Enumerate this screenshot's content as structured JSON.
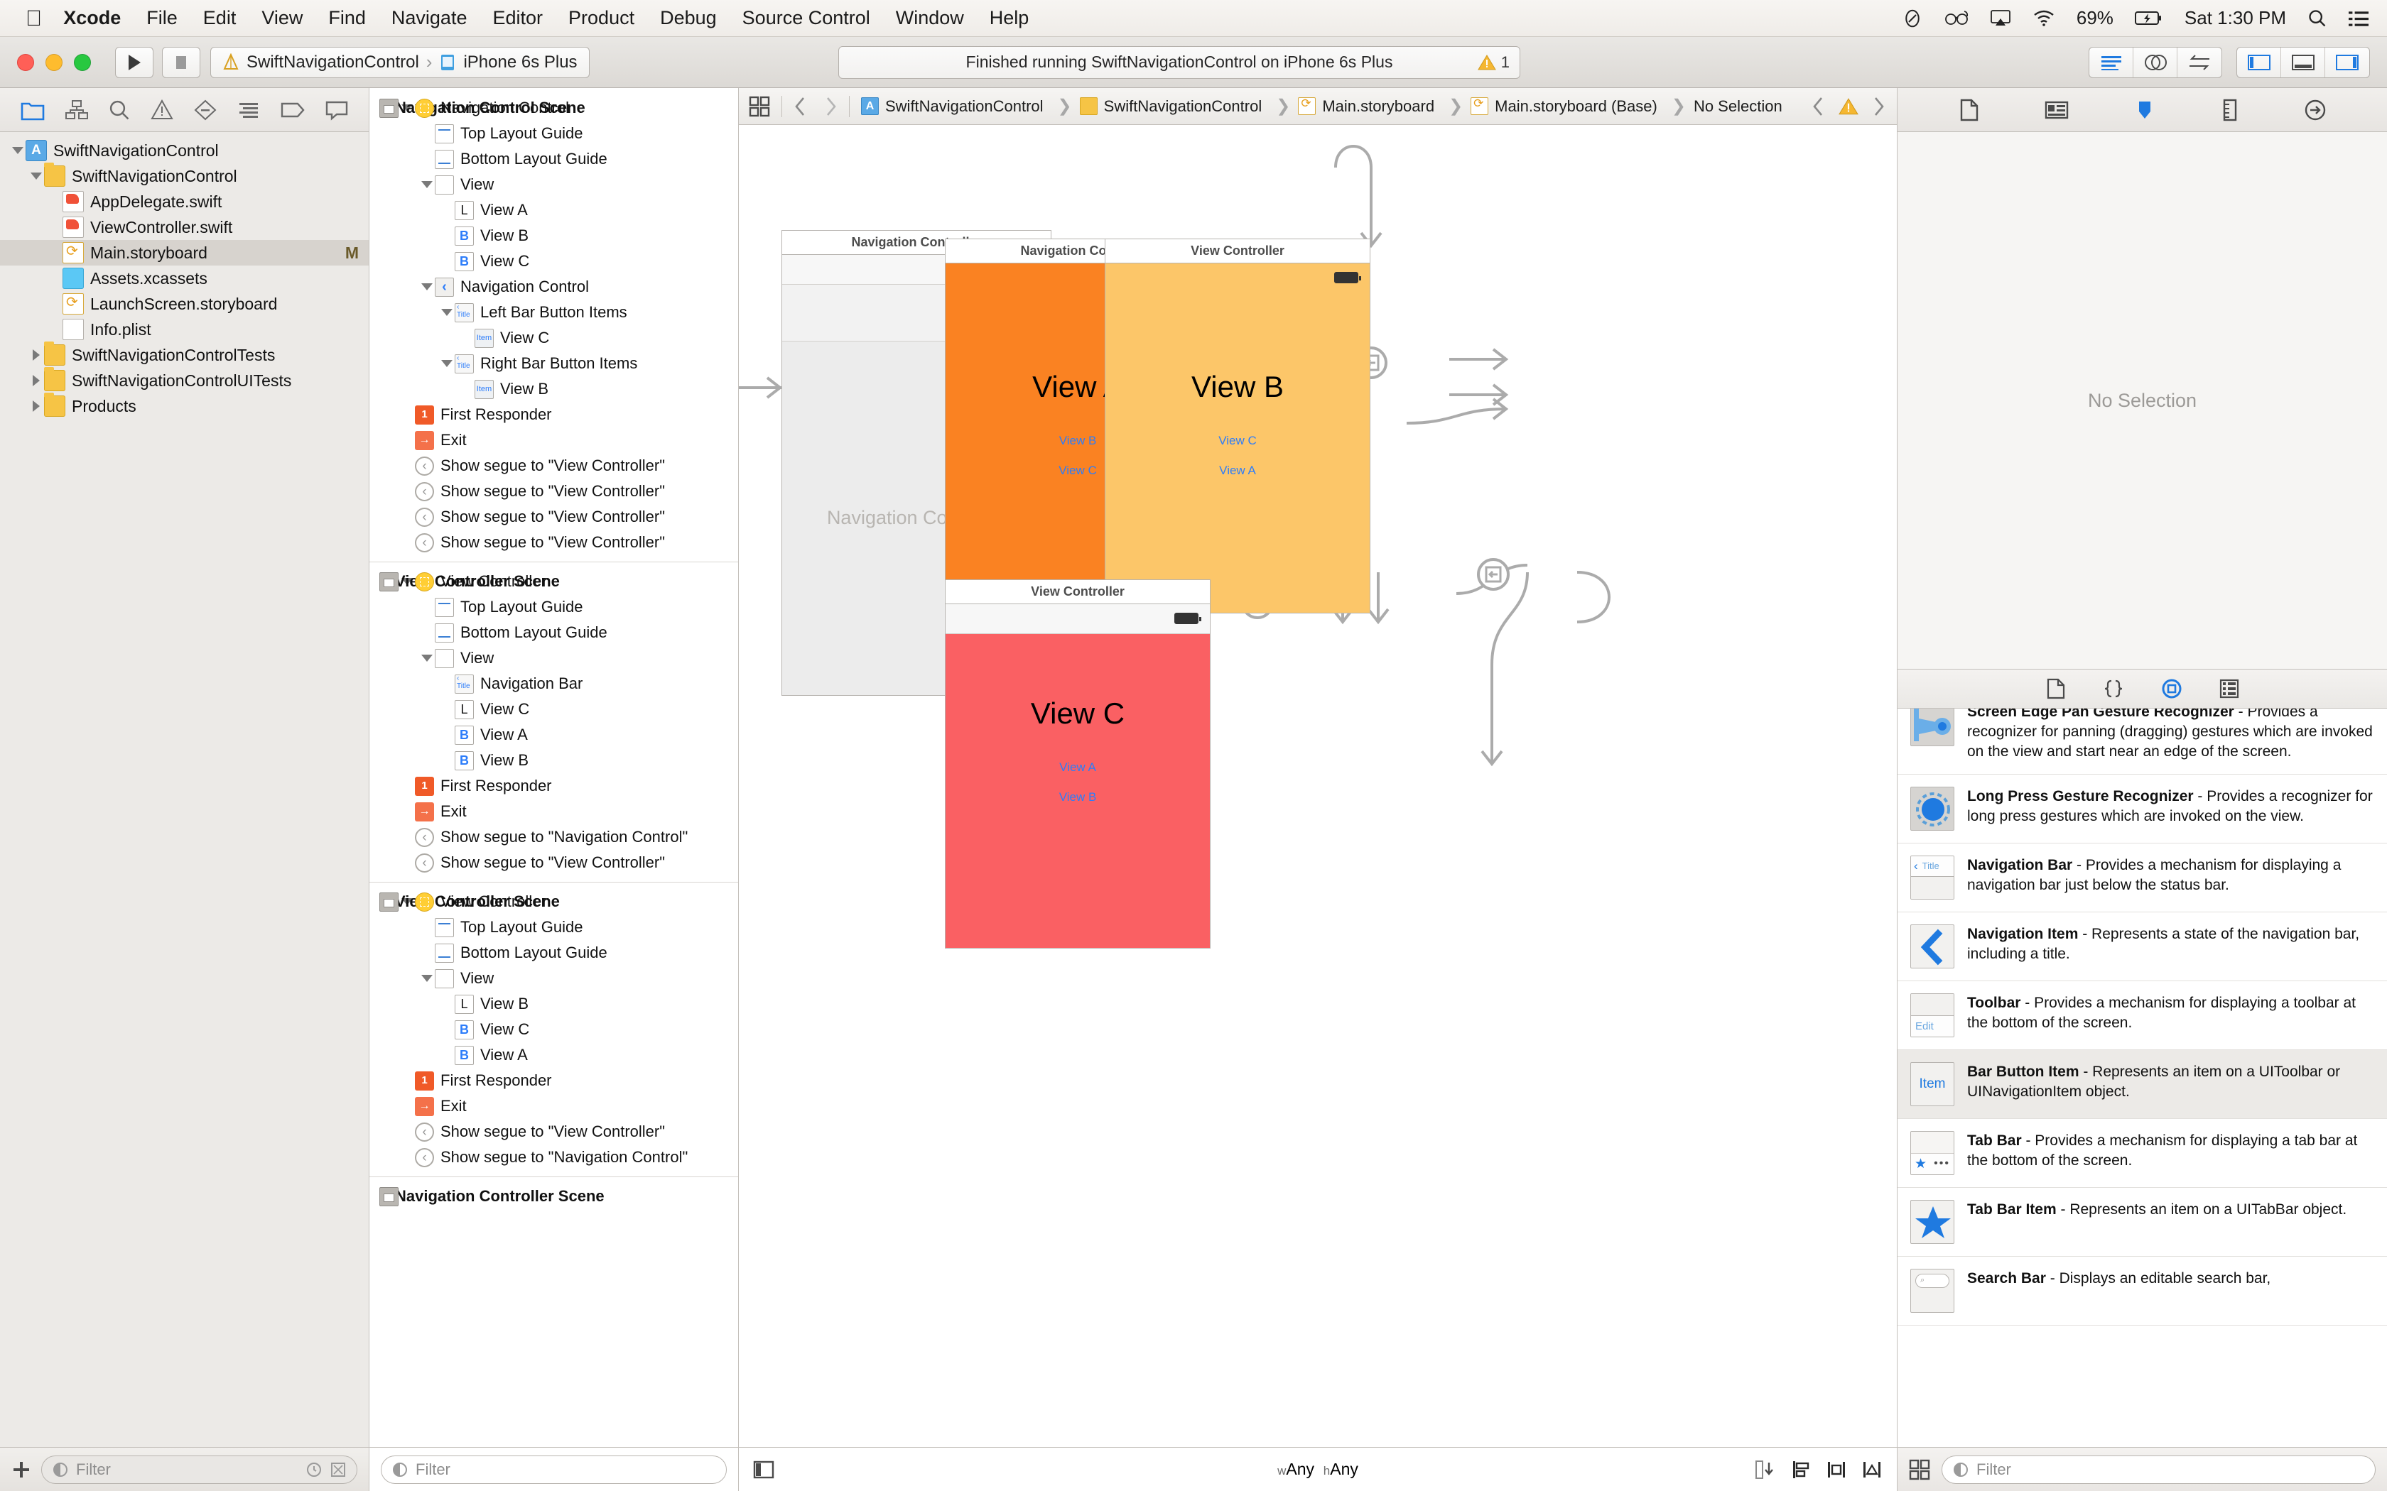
{
  "menubar": {
    "apple_icon": "apple-icon",
    "items": [
      "Xcode",
      "File",
      "Edit",
      "View",
      "Find",
      "Navigate",
      "Editor",
      "Product",
      "Debug",
      "Source Control",
      "Window",
      "Help"
    ],
    "status": {
      "battery_percent": "69%",
      "clock": "Sat 1:30 PM"
    }
  },
  "toolbar": {
    "scheme_name": "SwiftNavigationControl",
    "destination": "iPhone 6s Plus",
    "status_text": "Finished running SwiftNavigationControl on iPhone 6s Plus",
    "warning_count": "1"
  },
  "navigator": {
    "tree": [
      {
        "label": "SwiftNavigationControl",
        "indent": 0,
        "twisty": "down",
        "icon": "app",
        "selected": false,
        "mark": ""
      },
      {
        "label": "SwiftNavigationControl",
        "indent": 1,
        "twisty": "down",
        "icon": "folder",
        "selected": false,
        "mark": ""
      },
      {
        "label": "AppDelegate.swift",
        "indent": 2,
        "twisty": "",
        "icon": "swift",
        "selected": false,
        "mark": ""
      },
      {
        "label": "ViewController.swift",
        "indent": 2,
        "twisty": "",
        "icon": "swift",
        "selected": false,
        "mark": ""
      },
      {
        "label": "Main.storyboard",
        "indent": 2,
        "twisty": "",
        "icon": "sb",
        "selected": true,
        "mark": "M"
      },
      {
        "label": "Assets.xcassets",
        "indent": 2,
        "twisty": "",
        "icon": "assets",
        "selected": false,
        "mark": ""
      },
      {
        "label": "LaunchScreen.storyboard",
        "indent": 2,
        "twisty": "",
        "icon": "sb",
        "selected": false,
        "mark": ""
      },
      {
        "label": "Info.plist",
        "indent": 2,
        "twisty": "",
        "icon": "doc",
        "selected": false,
        "mark": ""
      },
      {
        "label": "SwiftNavigationControlTests",
        "indent": 1,
        "twisty": "right",
        "icon": "folder",
        "selected": false,
        "mark": ""
      },
      {
        "label": "SwiftNavigationControlUITests",
        "indent": 1,
        "twisty": "right",
        "icon": "folder",
        "selected": false,
        "mark": ""
      },
      {
        "label": "Products",
        "indent": 1,
        "twisty": "right",
        "icon": "folder",
        "selected": false,
        "mark": ""
      }
    ],
    "filter_placeholder": "Filter"
  },
  "outline": {
    "rows": [
      {
        "label": "Navigation Control Scene",
        "indent": 0,
        "twisty": "down",
        "icon": "scene",
        "scene": true
      },
      {
        "label": "Navigation Control",
        "indent": 1,
        "twisty": "down",
        "icon": "vc"
      },
      {
        "label": "Top Layout Guide",
        "indent": 2,
        "twisty": "",
        "icon": "guide-top"
      },
      {
        "label": "Bottom Layout Guide",
        "indent": 2,
        "twisty": "",
        "icon": "guide-bot"
      },
      {
        "label": "View",
        "indent": 2,
        "twisty": "down",
        "icon": "view"
      },
      {
        "label": "View A",
        "indent": 3,
        "twisty": "",
        "icon": "label-L"
      },
      {
        "label": "View B",
        "indent": 3,
        "twisty": "",
        "icon": "button-B"
      },
      {
        "label": "View C",
        "indent": 3,
        "twisty": "",
        "icon": "button-B"
      },
      {
        "label": "Navigation Control",
        "indent": 2,
        "twisty": "down",
        "icon": "navitem"
      },
      {
        "label": "Left Bar Button Items",
        "indent": 3,
        "twisty": "down",
        "icon": "navbar"
      },
      {
        "label": "View C",
        "indent": 4,
        "twisty": "",
        "icon": "baritem"
      },
      {
        "label": "Right Bar Button Items",
        "indent": 3,
        "twisty": "down",
        "icon": "navbar"
      },
      {
        "label": "View B",
        "indent": 4,
        "twisty": "",
        "icon": "baritem"
      },
      {
        "label": "First Responder",
        "indent": 1,
        "twisty": "",
        "icon": "first"
      },
      {
        "label": "Exit",
        "indent": 1,
        "twisty": "",
        "icon": "exit"
      },
      {
        "label": "Show segue to \"View Controller\"",
        "indent": 1,
        "twisty": "",
        "icon": "segue"
      },
      {
        "label": "Show segue to \"View Controller\"",
        "indent": 1,
        "twisty": "",
        "icon": "segue"
      },
      {
        "label": "Show segue to \"View Controller\"",
        "indent": 1,
        "twisty": "",
        "icon": "segue"
      },
      {
        "label": "Show segue to \"View Controller\"",
        "indent": 1,
        "twisty": "",
        "icon": "segue"
      },
      {
        "separator": true
      },
      {
        "label": "View Controller Scene",
        "indent": 0,
        "twisty": "down",
        "icon": "scene",
        "scene": true
      },
      {
        "label": "View Controller",
        "indent": 1,
        "twisty": "down",
        "icon": "vc"
      },
      {
        "label": "Top Layout Guide",
        "indent": 2,
        "twisty": "",
        "icon": "guide-top"
      },
      {
        "label": "Bottom Layout Guide",
        "indent": 2,
        "twisty": "",
        "icon": "guide-bot"
      },
      {
        "label": "View",
        "indent": 2,
        "twisty": "down",
        "icon": "view"
      },
      {
        "label": "Navigation Bar",
        "indent": 3,
        "twisty": "",
        "icon": "navbar"
      },
      {
        "label": "View C",
        "indent": 3,
        "twisty": "",
        "icon": "label-L"
      },
      {
        "label": "View A",
        "indent": 3,
        "twisty": "",
        "icon": "button-B"
      },
      {
        "label": "View B",
        "indent": 3,
        "twisty": "",
        "icon": "button-B"
      },
      {
        "label": "First Responder",
        "indent": 1,
        "twisty": "",
        "icon": "first"
      },
      {
        "label": "Exit",
        "indent": 1,
        "twisty": "",
        "icon": "exit"
      },
      {
        "label": "Show segue to \"Navigation Control\"",
        "indent": 1,
        "twisty": "",
        "icon": "segue"
      },
      {
        "label": "Show segue to \"View Controller\"",
        "indent": 1,
        "twisty": "",
        "icon": "segue"
      },
      {
        "separator": true
      },
      {
        "label": "View Controller Scene",
        "indent": 0,
        "twisty": "down",
        "icon": "scene",
        "scene": true
      },
      {
        "label": "View Controller",
        "indent": 1,
        "twisty": "down",
        "icon": "vc"
      },
      {
        "label": "Top Layout Guide",
        "indent": 2,
        "twisty": "",
        "icon": "guide-top"
      },
      {
        "label": "Bottom Layout Guide",
        "indent": 2,
        "twisty": "",
        "icon": "guide-bot"
      },
      {
        "label": "View",
        "indent": 2,
        "twisty": "down",
        "icon": "view"
      },
      {
        "label": "View B",
        "indent": 3,
        "twisty": "",
        "icon": "label-L"
      },
      {
        "label": "View C",
        "indent": 3,
        "twisty": "",
        "icon": "button-B"
      },
      {
        "label": "View A",
        "indent": 3,
        "twisty": "",
        "icon": "button-B"
      },
      {
        "label": "First Responder",
        "indent": 1,
        "twisty": "",
        "icon": "first"
      },
      {
        "label": "Exit",
        "indent": 1,
        "twisty": "",
        "icon": "exit"
      },
      {
        "label": "Show segue to \"View Controller\"",
        "indent": 1,
        "twisty": "",
        "icon": "segue"
      },
      {
        "label": "Show segue to \"Navigation Control\"",
        "indent": 1,
        "twisty": "",
        "icon": "segue"
      },
      {
        "separator": true
      },
      {
        "label": "Navigation Controller Scene",
        "indent": 0,
        "twisty": "right",
        "icon": "scene",
        "scene": true
      }
    ],
    "filter_placeholder": "Filter"
  },
  "jumpbar": {
    "crumbs": [
      {
        "label": "SwiftNavigationControl",
        "icon": "app"
      },
      {
        "label": "SwiftNavigationControl",
        "icon": "folder"
      },
      {
        "label": "Main.storyboard",
        "icon": "sb"
      },
      {
        "label": "Main.storyboard (Base)",
        "icon": "sb"
      },
      {
        "label": "No Selection",
        "icon": ""
      }
    ]
  },
  "canvas": {
    "scenes": [
      {
        "id": "navigation-controller",
        "title": "Navigation Controller",
        "body_color": "#ececec",
        "placeholder": "Navigation Controller",
        "view_title": "",
        "links": []
      },
      {
        "id": "view-a",
        "title": "Navigation Control",
        "body_color": "#FA8222",
        "view_title": "View A",
        "links": [
          "View B",
          "View C"
        ]
      },
      {
        "id": "view-b",
        "title": "View Controller",
        "body_color": "#FCC669",
        "view_title": "View B",
        "links": [
          "View C",
          "View A"
        ]
      },
      {
        "id": "view-c",
        "title": "View Controller",
        "body_color": "#FA6063",
        "view_title": "View C",
        "links": [
          "View A",
          "View B"
        ]
      }
    ],
    "size_class": {
      "w_prefix": "w",
      "w_value": "Any",
      "h_prefix": "h",
      "h_value": "Any"
    }
  },
  "inspector": {
    "no_selection": "No Selection",
    "library_items": [
      {
        "name": "Screen Edge Pan Gesture Recognizer",
        "desc": " - Provides a recognizer for panning (dragging) gestures which are invoked on the view and start near an edge of the screen.",
        "icon": "screen-edge-pan-gesture-icon",
        "selected": false,
        "clipped": true
      },
      {
        "name": "Long Press Gesture Recognizer",
        "desc": " - Provides a recognizer for long press gestures which are invoked on the view.",
        "icon": "long-press-gesture-icon",
        "selected": false
      },
      {
        "name": "Navigation Bar",
        "desc": " - Provides a mechanism for displaying a navigation bar just below the status bar.",
        "icon": "navigation-bar-icon",
        "icon_text": "Title",
        "selected": false
      },
      {
        "name": "Navigation Item",
        "desc": " - Represents a state of the navigation bar, including a title.",
        "icon": "navigation-item-icon",
        "selected": false
      },
      {
        "name": "Toolbar",
        "desc": " - Provides a mechanism for displaying a toolbar at the bottom of the screen.",
        "icon": "toolbar-icon",
        "icon_text": "Edit",
        "selected": false
      },
      {
        "name": "Bar Button Item",
        "desc": " - Represents an item on a UIToolbar or UINavigationItem object.",
        "icon": "bar-button-item-icon",
        "icon_text": "Item",
        "selected": true
      },
      {
        "name": "Tab Bar",
        "desc": " - Provides a mechanism for displaying a tab bar at the bottom of the screen.",
        "icon": "tab-bar-icon",
        "selected": false
      },
      {
        "name": "Tab Bar Item",
        "desc": " - Represents an item on a UITabBar object.",
        "icon": "tab-bar-item-icon",
        "selected": false
      },
      {
        "name": "Search Bar",
        "desc": " - Displays an editable search bar,",
        "icon": "search-bar-icon",
        "selected": false,
        "clipped": true
      }
    ],
    "filter_placeholder": "Filter"
  }
}
